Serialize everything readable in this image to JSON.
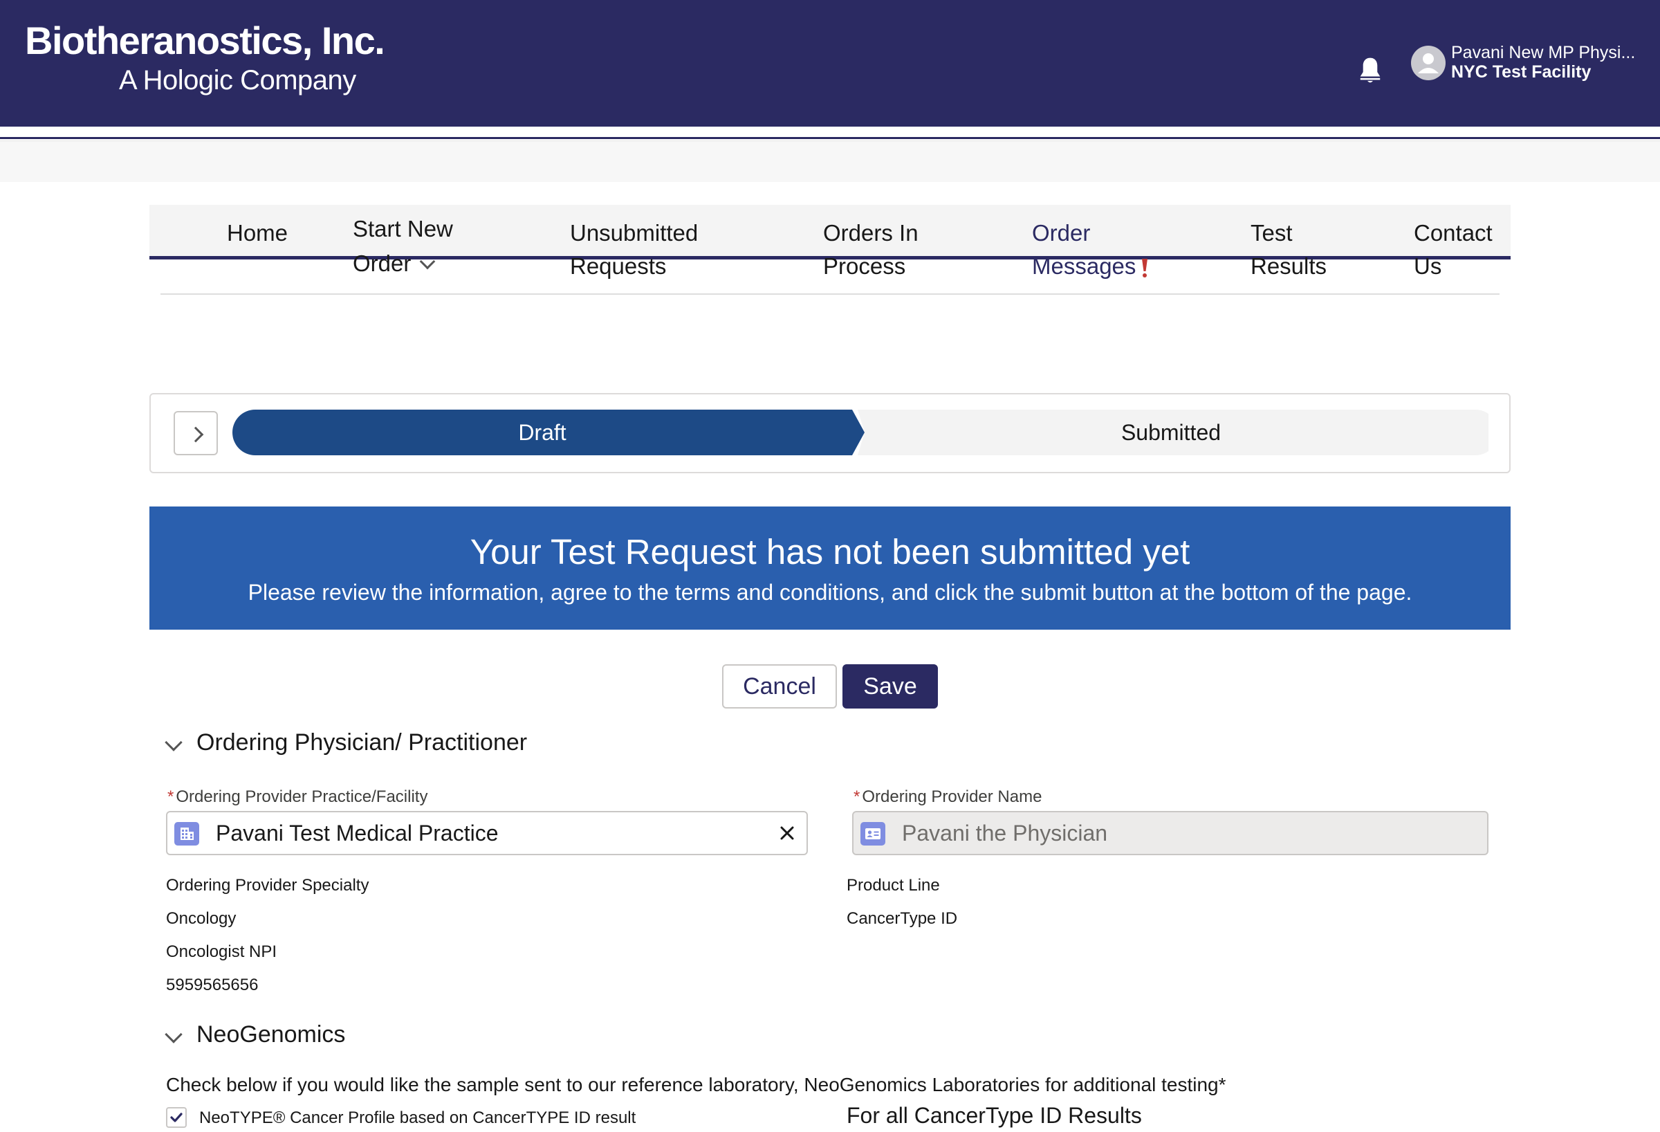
{
  "header": {
    "logo_main": "Biotheranostics, Inc.",
    "logo_sub": "A Hologic Company",
    "notification_icon": "bell-icon",
    "user_name": "Pavani New MP Physi...",
    "user_facility": "NYC Test Facility"
  },
  "nav": {
    "items": [
      {
        "line1": "Home",
        "line2": ""
      },
      {
        "line1": "Start New",
        "line2": "Order"
      },
      {
        "line1": "Unsubmitted",
        "line2": "Requests"
      },
      {
        "line1": "Orders In",
        "line2": "Process"
      },
      {
        "line1": "Order",
        "line2": "Messages"
      },
      {
        "line1": "Test",
        "line2": "Results"
      },
      {
        "line1": "Contact",
        "line2": "Us"
      }
    ],
    "active_color": "#2b2a62",
    "alert_color": "#c23934"
  },
  "path": {
    "steps": [
      "Draft",
      "Submitted"
    ],
    "current": "Draft",
    "active_color": "#1d4a86"
  },
  "banner": {
    "title": "Your Test Request has not been submitted yet",
    "message": "Please review the information, agree to the terms and conditions, and click the submit button at the bottom of the page."
  },
  "actions": {
    "cancel_label": "Cancel",
    "save_label": "Save"
  },
  "physician_section": {
    "title": "Ordering Physician/ Practitioner",
    "facility_label": "Ordering Provider Practice/Facility",
    "facility_value": "Pavani Test Medical Practice",
    "provider_label": "Ordering Provider Name",
    "provider_value": "Pavani the Physician",
    "specialty_label": "Ordering Provider Specialty",
    "specialty_value": "Oncology",
    "npi_label": "Oncologist NPI",
    "npi_value": "5959565656",
    "product_line_label": "Product Line",
    "product_line_value": "CancerType ID"
  },
  "neogenomics_section": {
    "title": "NeoGenomics",
    "instruction": "Check below if you would like the sample sent to our reference laboratory, NeoGenomics Laboratories for additional testing*",
    "checkbox_label": "NeoTYPE® Cancer Profile based on CancerTYPE ID result",
    "checkbox_checked": true,
    "right_heading": "For all CancerType ID Results"
  }
}
